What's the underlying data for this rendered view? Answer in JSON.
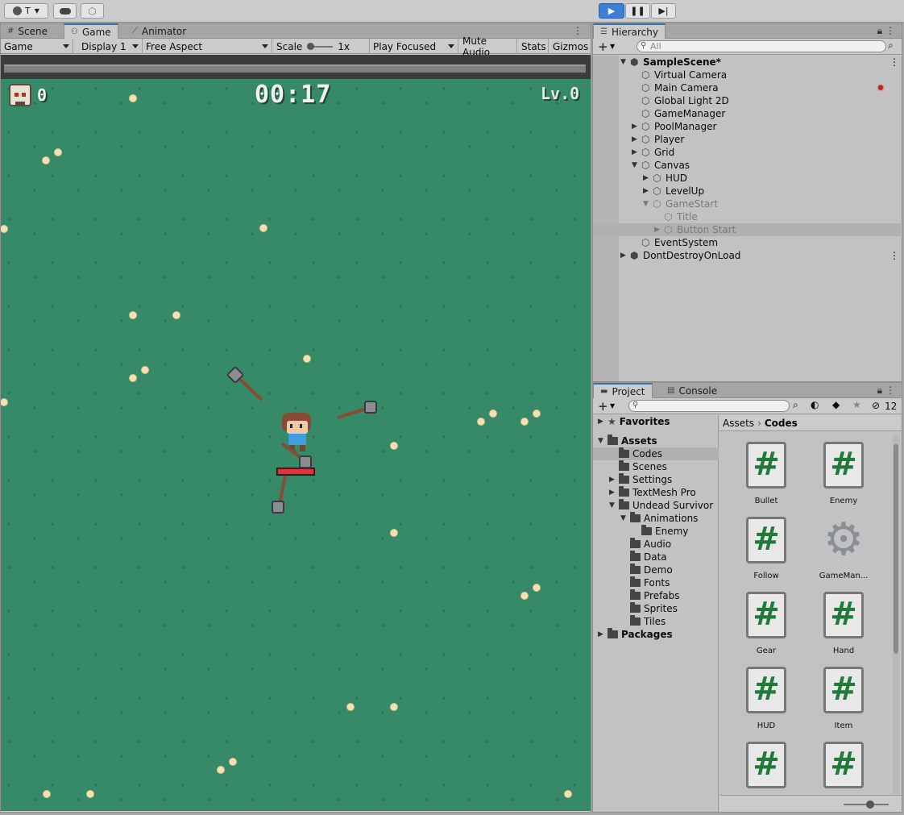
{
  "toolbar": {
    "account_label": "T",
    "account_icon": "account-icon",
    "cloud_icon": "cloud-icon",
    "collab_icon": "collab-icon",
    "play_icon": "play-icon",
    "pause_icon": "pause-icon",
    "step_icon": "step-icon"
  },
  "scene_tabs": [
    {
      "label": "Scene",
      "icon": "#"
    },
    {
      "label": "Game",
      "icon": "⚇"
    },
    {
      "label": "Animator",
      "icon": "⟋"
    }
  ],
  "game_controls": {
    "display_mode": "Game",
    "display": "Display 1",
    "aspect": "Free Aspect",
    "scale_label": "Scale",
    "scale_value": "1x",
    "play_mode": "Play Focused",
    "mute": "Mute Audio",
    "stats": "Stats",
    "gizmos": "Gizmos"
  },
  "game": {
    "kills": "0",
    "timer": "00:17",
    "level": "Lv.0"
  },
  "hierarchy": {
    "tab": "Hierarchy",
    "add": "+",
    "search_placeholder": "All",
    "items": [
      {
        "label": "SampleScene*",
        "depth": 0,
        "arrow": "▼",
        "bold": true,
        "icon": "unity"
      },
      {
        "label": "Virtual Camera",
        "depth": 1,
        "arrow": "",
        "icon": "cube"
      },
      {
        "label": "Main Camera",
        "depth": 1,
        "arrow": "",
        "icon": "cube"
      },
      {
        "label": "Global Light 2D",
        "depth": 1,
        "arrow": "",
        "icon": "cube"
      },
      {
        "label": "GameManager",
        "depth": 1,
        "arrow": "",
        "icon": "cube"
      },
      {
        "label": "PoolManager",
        "depth": 1,
        "arrow": "▶",
        "icon": "cube"
      },
      {
        "label": "Player",
        "depth": 1,
        "arrow": "▶",
        "icon": "cube"
      },
      {
        "label": "Grid",
        "depth": 1,
        "arrow": "▶",
        "icon": "cube"
      },
      {
        "label": "Canvas",
        "depth": 1,
        "arrow": "▼",
        "icon": "cube"
      },
      {
        "label": "HUD",
        "depth": 2,
        "arrow": "▶",
        "icon": "cube"
      },
      {
        "label": "LevelUp",
        "depth": 2,
        "arrow": "▶",
        "icon": "cube"
      },
      {
        "label": "GameStart",
        "depth": 2,
        "arrow": "▼",
        "icon": "cube",
        "dim": true
      },
      {
        "label": "Title",
        "depth": 3,
        "arrow": "",
        "icon": "cube",
        "dim": true
      },
      {
        "label": "Button Start",
        "depth": 3,
        "arrow": "▶",
        "icon": "cube",
        "dim": true,
        "selected": true
      },
      {
        "label": "EventSystem",
        "depth": 1,
        "arrow": "",
        "icon": "cube"
      },
      {
        "label": "DontDestroyOnLoad",
        "depth": 0,
        "arrow": "▶",
        "icon": "unity"
      }
    ]
  },
  "project": {
    "tabs": [
      "Project",
      "Console"
    ],
    "add": "+",
    "hidden_count": "12",
    "breadcrumb": [
      "Assets",
      "Codes"
    ],
    "tree": [
      {
        "label": "Favorites",
        "depth": 0,
        "arrow": "▶",
        "bold": true,
        "icon": "star"
      },
      {
        "label": "Assets",
        "depth": 0,
        "arrow": "▼",
        "bold": true,
        "icon": "folder"
      },
      {
        "label": "Codes",
        "depth": 1,
        "arrow": "",
        "icon": "folder",
        "selected": true
      },
      {
        "label": "Scenes",
        "depth": 1,
        "arrow": "",
        "icon": "folder"
      },
      {
        "label": "Settings",
        "depth": 1,
        "arrow": "▶",
        "icon": "folder"
      },
      {
        "label": "TextMesh Pro",
        "depth": 1,
        "arrow": "▶",
        "icon": "folder"
      },
      {
        "label": "Undead Survivor",
        "depth": 1,
        "arrow": "▼",
        "icon": "folder"
      },
      {
        "label": "Animations",
        "depth": 2,
        "arrow": "▼",
        "icon": "folder"
      },
      {
        "label": "Enemy",
        "depth": 3,
        "arrow": "",
        "icon": "folder"
      },
      {
        "label": "Audio",
        "depth": 2,
        "arrow": "",
        "icon": "folder"
      },
      {
        "label": "Data",
        "depth": 2,
        "arrow": "",
        "icon": "folder"
      },
      {
        "label": "Demo",
        "depth": 2,
        "arrow": "",
        "icon": "folder"
      },
      {
        "label": "Fonts",
        "depth": 2,
        "arrow": "",
        "icon": "folder"
      },
      {
        "label": "Prefabs",
        "depth": 2,
        "arrow": "",
        "icon": "folder"
      },
      {
        "label": "Sprites",
        "depth": 2,
        "arrow": "",
        "icon": "folder"
      },
      {
        "label": "Tiles",
        "depth": 2,
        "arrow": "",
        "icon": "folder"
      },
      {
        "label": "Packages",
        "depth": 0,
        "arrow": "▶",
        "bold": true,
        "icon": "folder"
      }
    ],
    "assets": [
      {
        "label": "Bullet",
        "type": "script"
      },
      {
        "label": "Enemy",
        "type": "script"
      },
      {
        "label": "Follow",
        "type": "script"
      },
      {
        "label": "GameMan...",
        "type": "gear"
      },
      {
        "label": "Gear",
        "type": "script"
      },
      {
        "label": "Hand",
        "type": "script"
      },
      {
        "label": "HUD",
        "type": "script"
      },
      {
        "label": "Item",
        "type": "script"
      },
      {
        "label": "",
        "type": "script"
      },
      {
        "label": "",
        "type": "script"
      }
    ]
  }
}
